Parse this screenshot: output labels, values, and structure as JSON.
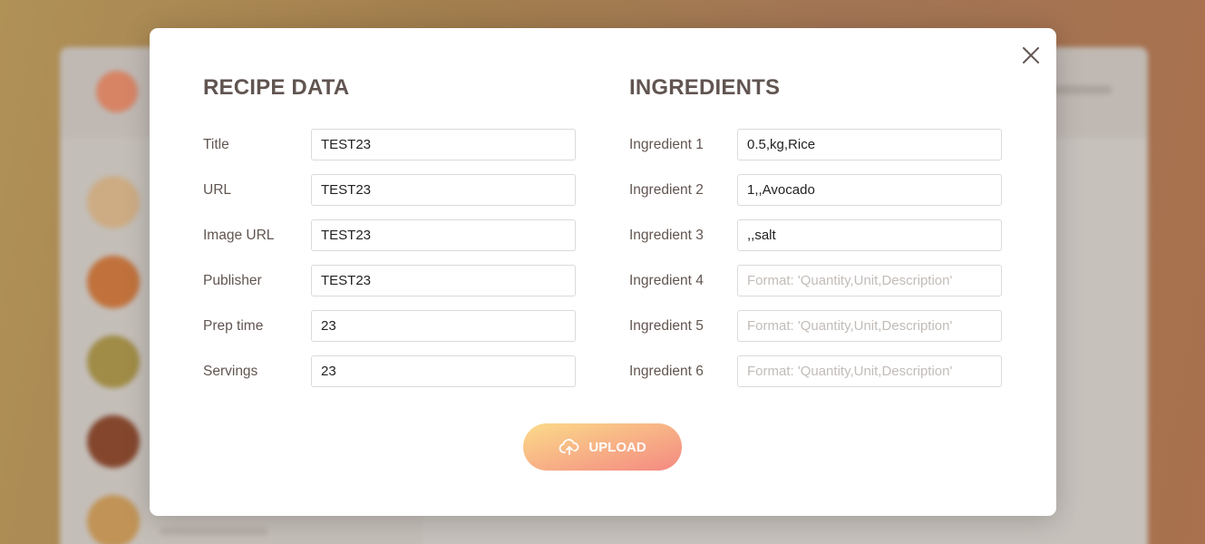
{
  "recipe": {
    "heading": "RECIPE DATA",
    "fields": [
      {
        "label": "Title",
        "value": "TEST23",
        "placeholder": ""
      },
      {
        "label": "URL",
        "value": "TEST23",
        "placeholder": ""
      },
      {
        "label": "Image URL",
        "value": "TEST23",
        "placeholder": ""
      },
      {
        "label": "Publisher",
        "value": "TEST23",
        "placeholder": ""
      },
      {
        "label": "Prep time",
        "value": "23",
        "placeholder": ""
      },
      {
        "label": "Servings",
        "value": "23",
        "placeholder": ""
      }
    ]
  },
  "ingredients": {
    "heading": "INGREDIENTS",
    "fields": [
      {
        "label": "Ingredient 1",
        "value": "0.5,kg,Rice",
        "placeholder": "Format: 'Quantity,Unit,Description'"
      },
      {
        "label": "Ingredient 2",
        "value": "1,,Avocado",
        "placeholder": "Format: 'Quantity,Unit,Description'"
      },
      {
        "label": "Ingredient 3",
        "value": ",,salt",
        "placeholder": "Format: 'Quantity,Unit,Description'"
      },
      {
        "label": "Ingredient 4",
        "value": "",
        "placeholder": "Format: 'Quantity,Unit,Description'"
      },
      {
        "label": "Ingredient 5",
        "value": "",
        "placeholder": "Format: 'Quantity,Unit,Description'"
      },
      {
        "label": "Ingredient 6",
        "value": "",
        "placeholder": "Format: 'Quantity,Unit,Description'"
      }
    ]
  },
  "upload": {
    "label": "UPLOAD",
    "icon": "cloud-upload-icon"
  },
  "close": {
    "icon": "close-icon"
  },
  "colors": {
    "text": "#615551",
    "gradient_start": "#fbdb89",
    "gradient_end": "#f48982",
    "input_border": "#dddad8"
  }
}
